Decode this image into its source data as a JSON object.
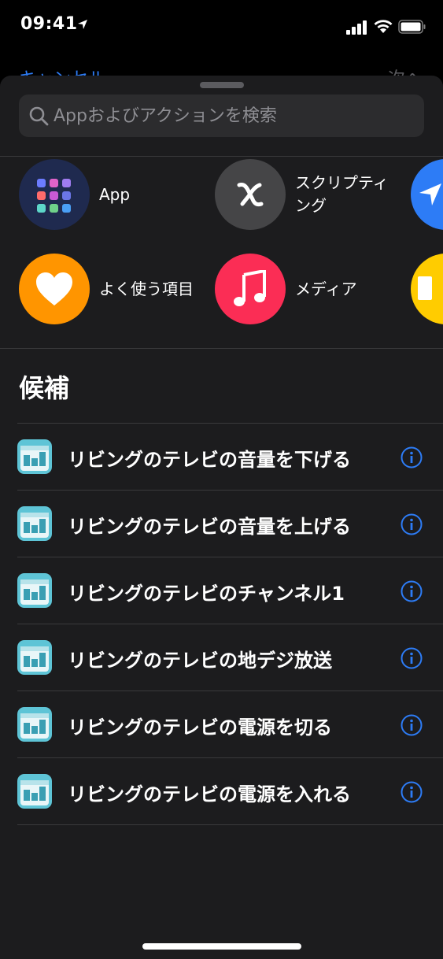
{
  "status_bar": {
    "time": "09:41"
  },
  "background_nav": {
    "cancel_label": "キャンセル",
    "next_label": "次へ"
  },
  "search": {
    "placeholder": "Appおよびアクションを検索"
  },
  "categories": [
    {
      "label": "App",
      "icon": "app-grid-icon",
      "color": "#1f2a4f"
    },
    {
      "label": "スクリプティング",
      "icon": "scripting-x-icon",
      "color": "#454547"
    },
    {
      "label": "",
      "icon": "location-arrow-icon",
      "color": "#2d7cf6"
    },
    {
      "label": "よく使う項目",
      "icon": "heart-icon",
      "color": "#ff9500"
    },
    {
      "label": "メディア",
      "icon": "music-note-icon",
      "color": "#fb2d55"
    },
    {
      "label": "",
      "icon": "documents-icon",
      "color": "#ffcc00"
    }
  ],
  "suggestions": {
    "title": "候補",
    "items": [
      {
        "label": "リビングのテレビの音量を下げる"
      },
      {
        "label": "リビングのテレビの音量を上げる"
      },
      {
        "label": "リビングのテレビのチャンネル1"
      },
      {
        "label": "リビングのテレビの地デジ放送"
      },
      {
        "label": "リビングのテレビの電源を切る"
      },
      {
        "label": "リビングのテレビの電源を入れる"
      }
    ]
  },
  "colors": {
    "accent": "#2d7cf6",
    "sheet_bg": "#1c1c1e",
    "search_bg": "#2c2c2e"
  }
}
